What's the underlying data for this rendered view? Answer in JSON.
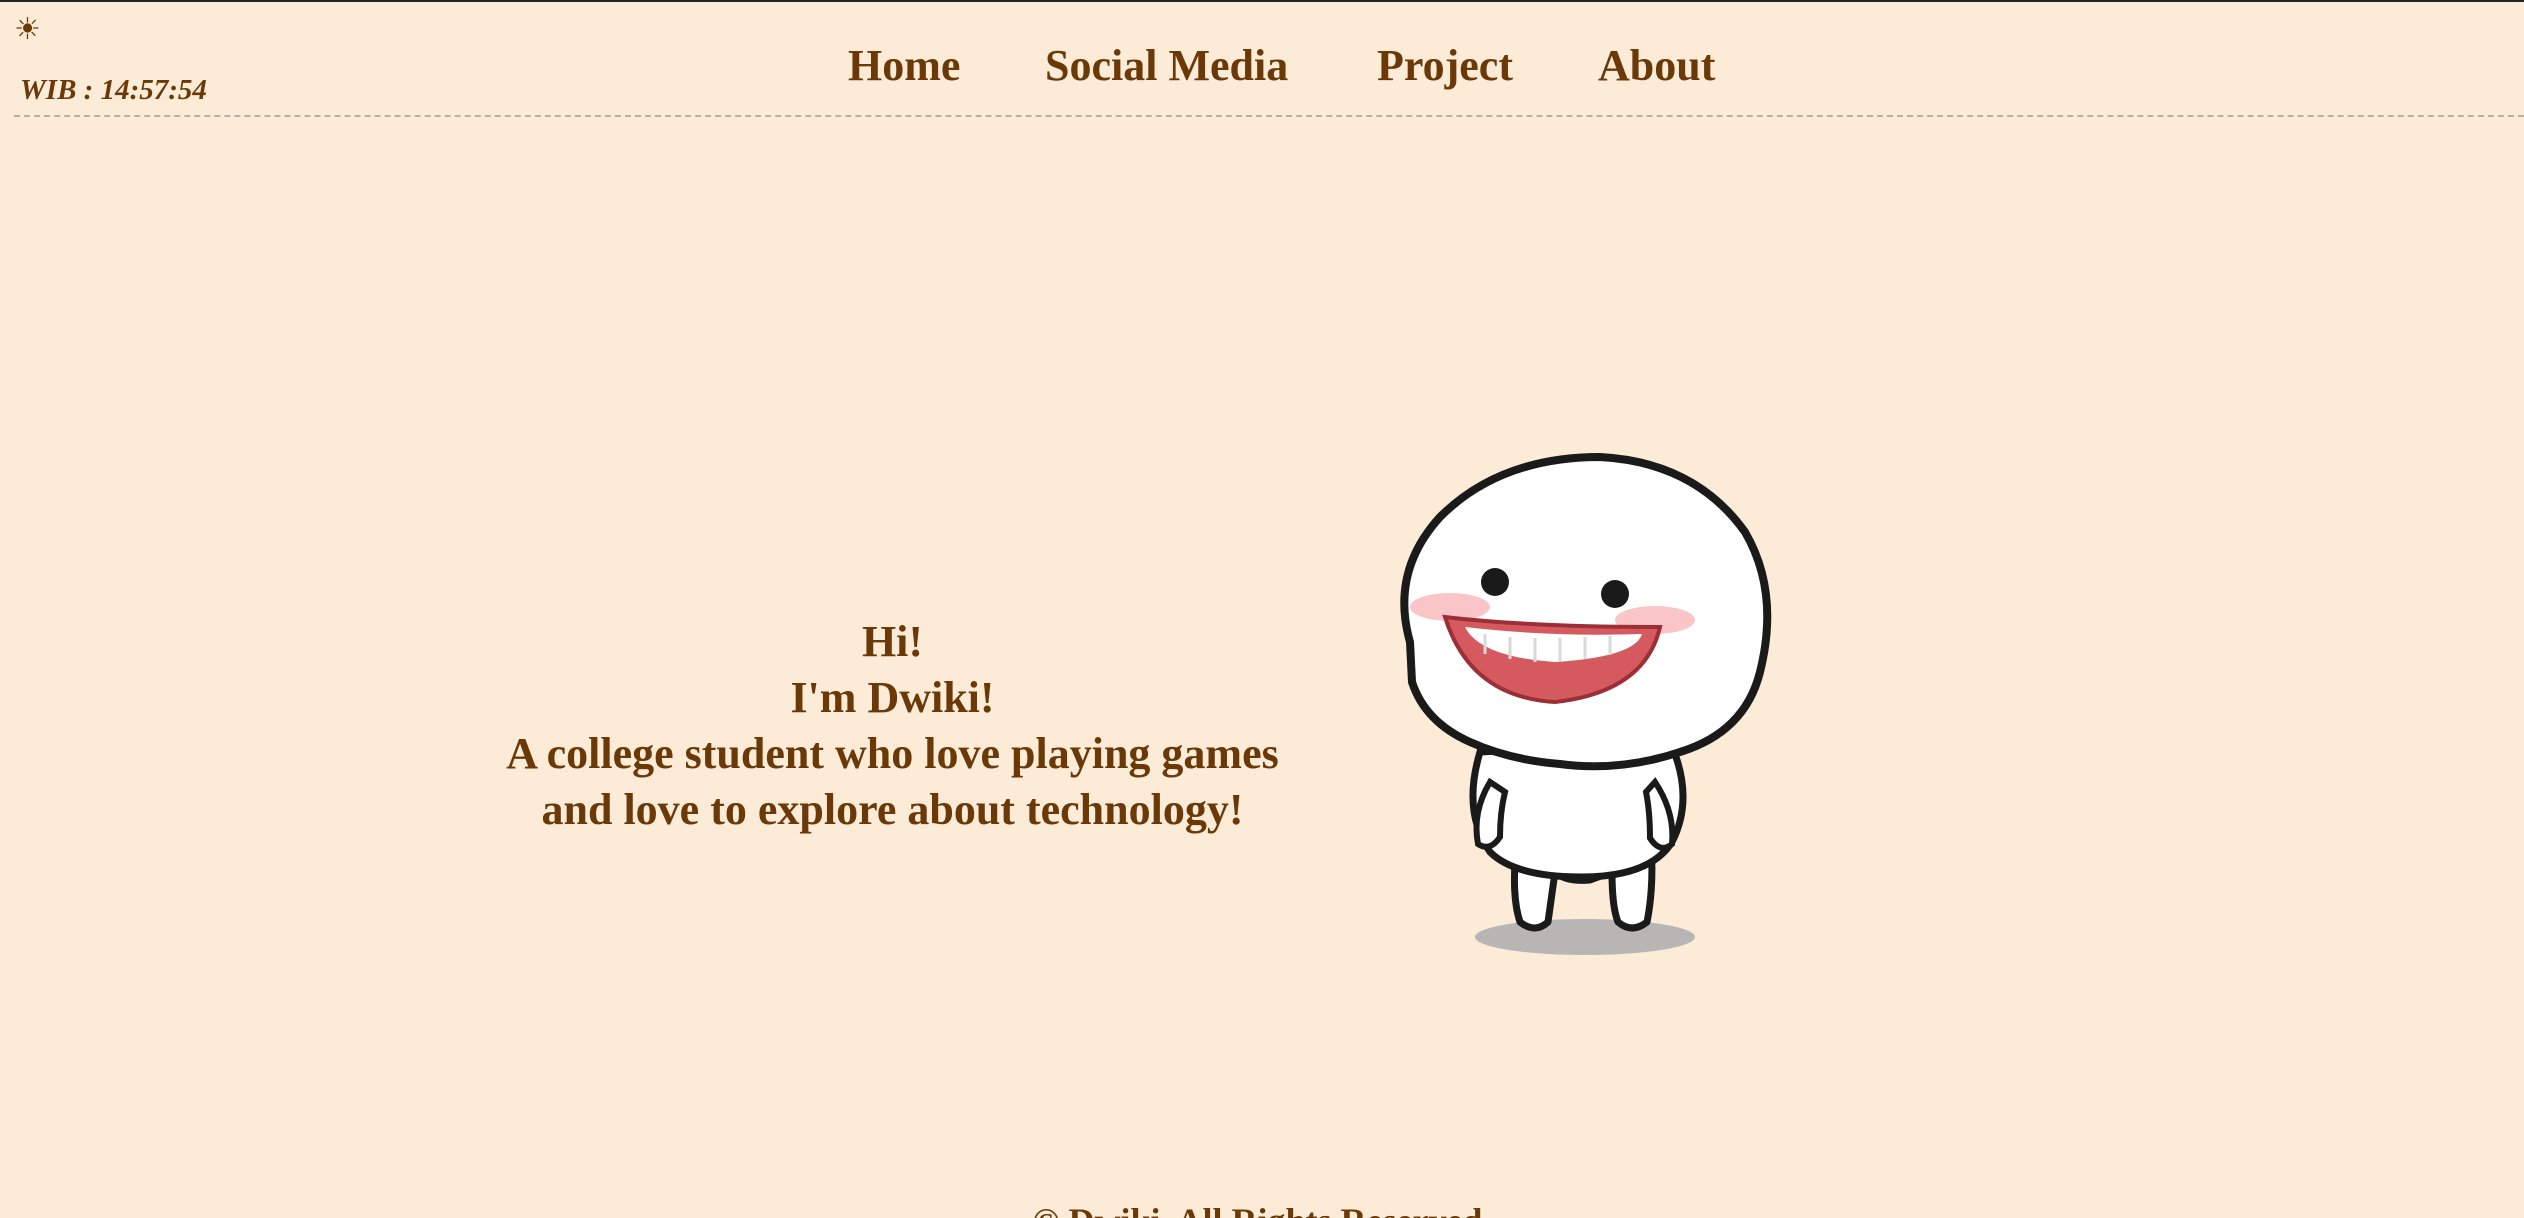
{
  "header": {
    "theme_toggle_icon": "sun-icon",
    "theme_toggle_glyph": "☀",
    "clock_text": "WIB : 14:57:54"
  },
  "nav": {
    "items": [
      {
        "label": "Home"
      },
      {
        "label": "Social Media"
      },
      {
        "label": "Project"
      },
      {
        "label": "About"
      }
    ]
  },
  "hero": {
    "line1": "Hi!",
    "line2": "I'm Dwiki!",
    "line3": "A college student who love playing games",
    "line4": "and love to explore about technology!"
  },
  "colors": {
    "background": "#fbebd7",
    "text": "#6b3808",
    "divider": "#b7b0aa"
  },
  "footer": {
    "text": "© Dwiki. All Rights Reserved."
  }
}
